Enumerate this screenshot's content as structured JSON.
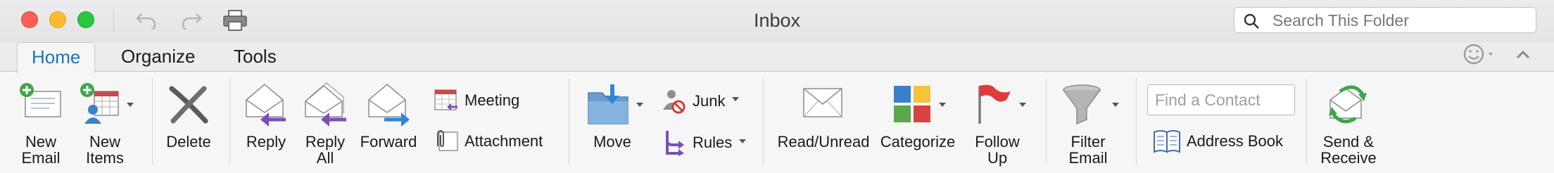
{
  "window": {
    "title": "Inbox"
  },
  "search": {
    "placeholder": "Search This Folder"
  },
  "tabs": [
    {
      "label": "Home",
      "active": true
    },
    {
      "label": "Organize",
      "active": false
    },
    {
      "label": "Tools",
      "active": false
    }
  ],
  "ribbon": {
    "new_email": {
      "line1": "New",
      "line2": "Email"
    },
    "new_items": {
      "line1": "New",
      "line2": "Items"
    },
    "delete": "Delete",
    "reply": "Reply",
    "reply_all": {
      "line1": "Reply",
      "line2": "All"
    },
    "forward": "Forward",
    "meeting": "Meeting",
    "attachment": "Attachment",
    "move": "Move",
    "junk": "Junk",
    "rules": "Rules",
    "read_unread": "Read/Unread",
    "categorize": "Categorize",
    "follow_up": {
      "line1": "Follow",
      "line2": "Up"
    },
    "filter_email": {
      "line1": "Filter",
      "line2": "Email"
    },
    "find_contact": {
      "placeholder": "Find a Contact"
    },
    "address_book": "Address Book",
    "send_receive": {
      "line1": "Send &",
      "line2": "Receive"
    }
  },
  "colors": {
    "accent": "#1b75bc",
    "close": "#fc5f57",
    "minimize": "#fdbc2e",
    "zoom": "#28c840",
    "flag": "#e03b3b",
    "arrow_purple": "#7b4fb8",
    "arrow_blue": "#2f86d6"
  }
}
